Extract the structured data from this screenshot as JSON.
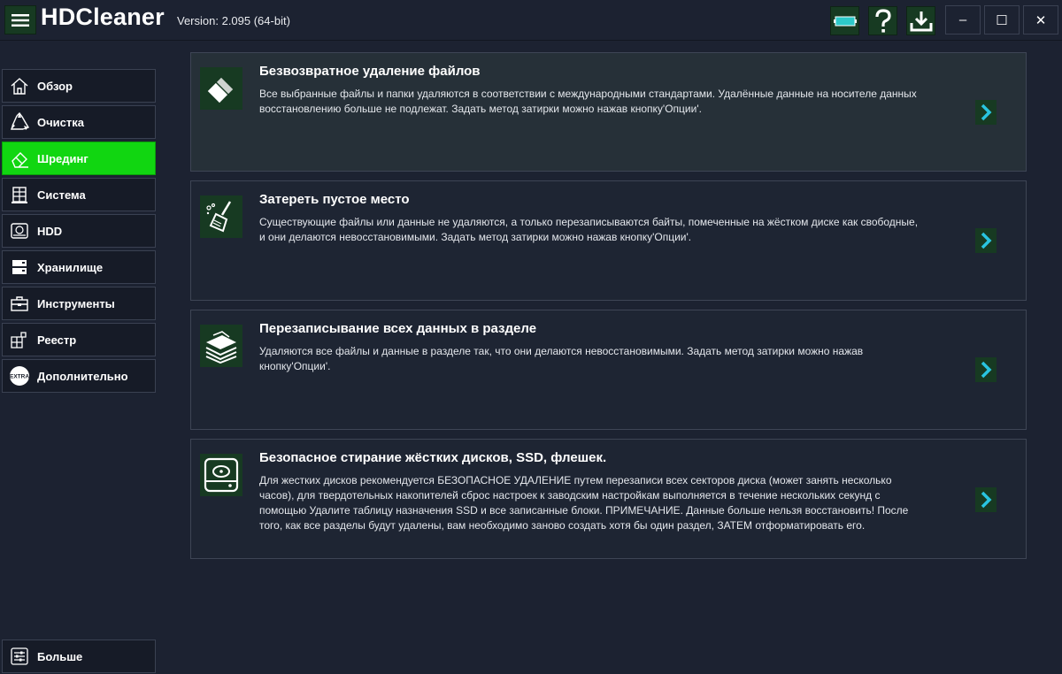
{
  "app": {
    "title": "HDCleaner",
    "version": "Version: 2.095 (64-bit)"
  },
  "titlebar": {
    "icons": [
      "battery-icon",
      "help-icon",
      "download-icon"
    ],
    "window_buttons": {
      "minimize": "–",
      "maximize": "☐",
      "close": "✕"
    }
  },
  "sidebar": {
    "items": [
      {
        "label": "Обзор",
        "icon": "home-icon"
      },
      {
        "label": "Очистка",
        "icon": "recycle-icon"
      },
      {
        "label": "Шрединг",
        "icon": "eraser-icon",
        "active": true
      },
      {
        "label": "Система",
        "icon": "system-icon"
      },
      {
        "label": "HDD",
        "icon": "hdd-icon"
      },
      {
        "label": "Хранилище",
        "icon": "storage-icon"
      },
      {
        "label": "Инструменты",
        "icon": "toolbox-icon"
      },
      {
        "label": "Реестр",
        "icon": "registry-icon"
      },
      {
        "label": "Дополнительно",
        "icon": "extra-icon"
      }
    ],
    "more": {
      "label": "Больше",
      "icon": "sliders-icon"
    },
    "extra_badge": "EXTRA"
  },
  "cards": [
    {
      "title": "Безвозвратное удаление файлов",
      "description": "Все выбранные файлы и папки удаляются в соответствии с международными стандартами. Удалённые данные на носителе данных восстановлению больше не подлежат. Задать метод затирки можно нажав кнопку'Опции'.",
      "icon": "eraser-icon"
    },
    {
      "title": "Затереть пустое место",
      "description": "Существующие файлы или данные не удаляются, а только перезаписываются байты, помеченные на жёстком диске как свободные, и они делаются невосстановимыми. Задать метод затирки можно нажав кнопку'Опции'.",
      "icon": "broom-icon"
    },
    {
      "title": "Перезаписывание всех данных в разделе",
      "description": "Удаляются все файлы и данные в разделе так, что они делаются невосстановимыми. Задать метод затирки можно нажав кнопку'Опции'.",
      "icon": "layers-icon"
    },
    {
      "title": "Безопасное стирание жёстких дисков, SSD, флешек.",
      "description": "Для жестких дисков рекомендуется БЕЗОПАСНОЕ УДАЛЕНИЕ путем перезаписи всех секторов диска (может занять несколько часов), для твердотельных накопителей сброс настроек к заводским настройкам выполняется в течение нескольких секунд с помощью Удалите таблицу назначения SSD и все записанные блоки. ПРИМЕЧАНИЕ. Данные больше нельзя восстановить! После того, как все разделы будут удалены, вам необходимо заново создать хотя бы один раздел, ЗАТЕМ отформатировать его.",
      "icon": "hdd-icon"
    }
  ],
  "colors": {
    "background": "#1c2231",
    "accent": "#11d611",
    "icon_bg": "#173a22",
    "arrow": "#29c4e0"
  }
}
